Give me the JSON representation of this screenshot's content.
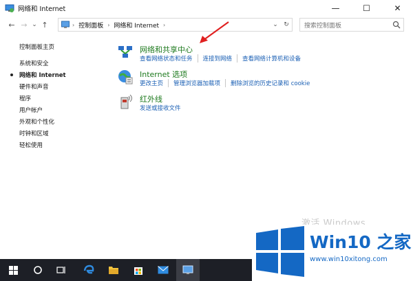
{
  "window": {
    "title": "网络和 Internet",
    "controls": {
      "minimize": "—",
      "maximize": "☐",
      "close": "✕"
    }
  },
  "nav": {
    "back": "←",
    "forward": "→",
    "recent": "⌄",
    "up": "↑",
    "breadcrumb": [
      "控制面板",
      "网络和 Internet"
    ],
    "refresh": "↻",
    "dropdown": "⌄",
    "search_placeholder": "搜索控制面板"
  },
  "sidebar": {
    "home": "控制面板主页",
    "items": [
      {
        "label": "系统和安全"
      },
      {
        "label": "网络和 Internet",
        "active": true
      },
      {
        "label": "硬件和声音"
      },
      {
        "label": "程序"
      },
      {
        "label": "用户帐户"
      },
      {
        "label": "外观和个性化"
      },
      {
        "label": "时钟和区域"
      },
      {
        "label": "轻松使用"
      }
    ]
  },
  "sections": [
    {
      "title": "网络和共享中心",
      "icon": "network-sharing-icon",
      "links": [
        "查看网络状态和任务",
        "连接到网络",
        "查看网络计算机和设备"
      ]
    },
    {
      "title": "Internet 选项",
      "icon": "internet-options-icon",
      "links": [
        "更改主页",
        "管理浏览器加载项",
        "删除浏览的历史记录和 cookie"
      ]
    },
    {
      "title": "红外线",
      "icon": "infrared-icon",
      "links": [
        "发送或接收文件"
      ]
    }
  ],
  "watermark": "激活 Windows",
  "badge": {
    "name": "Win10 之家",
    "url": "www.win10xitong.com"
  },
  "colors": {
    "section_title": "#1e7a1e",
    "link": "#1a5fb4",
    "taskbar": "#1d1f26",
    "arrow": "#e02020",
    "brand": "#1468c4"
  },
  "taskbar_icons": [
    "windows-start-icon",
    "cortana-icon",
    "task-view-icon",
    "edge-icon",
    "file-explorer-icon",
    "store-icon",
    "mail-icon",
    "control-panel-icon"
  ]
}
